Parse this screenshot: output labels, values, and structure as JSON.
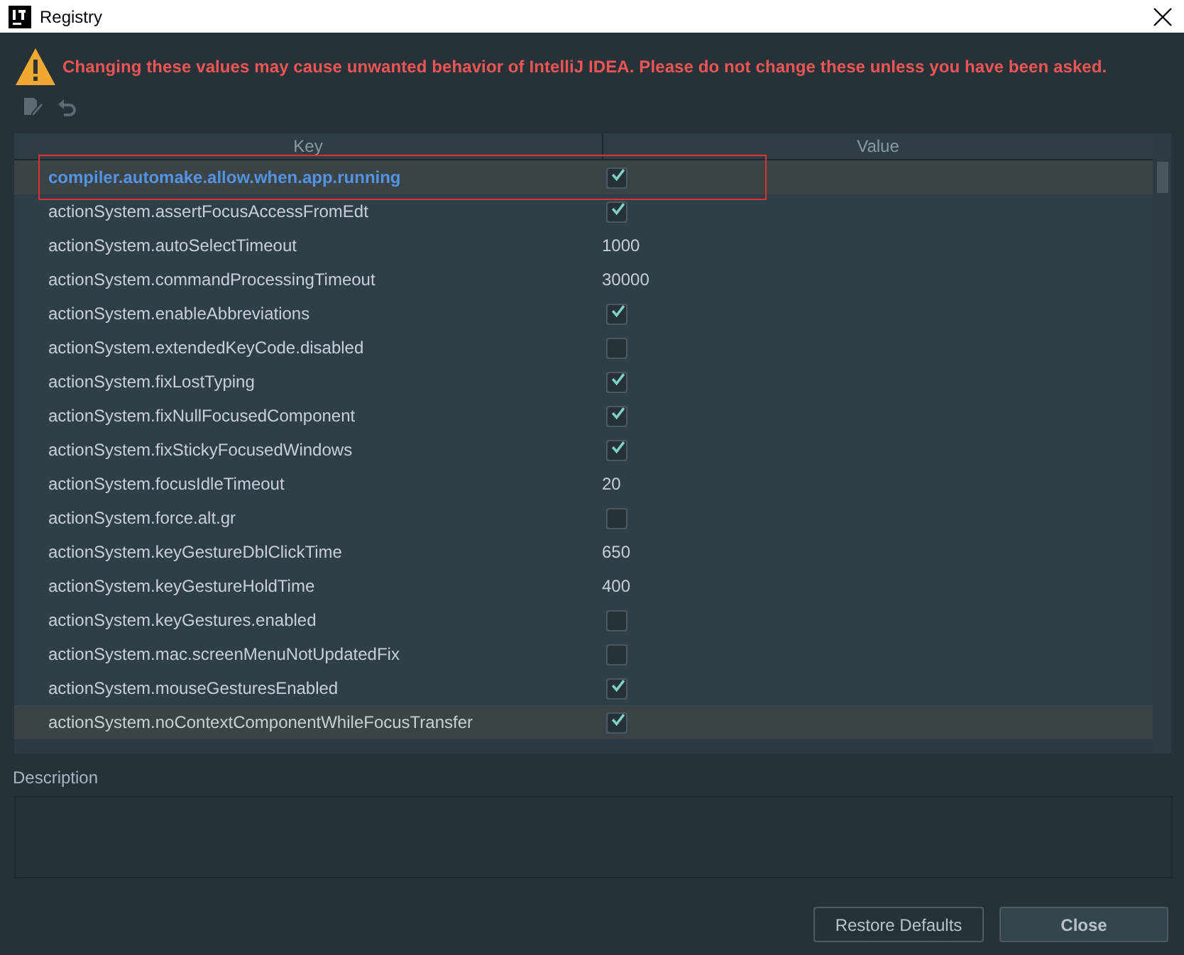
{
  "window": {
    "title": "Registry"
  },
  "warning": "Changing these values may cause unwanted behavior of IntelliJ IDEA. Please do not change these unless you have been asked.",
  "table": {
    "columns": [
      "Key",
      "Value"
    ],
    "annotation_box": true,
    "rows": [
      {
        "key": "compiler.automake.allow.when.app.running",
        "kind": "checkbox",
        "checked": true,
        "selected": true,
        "modified": true
      },
      {
        "key": "actionSystem.assertFocusAccessFromEdt",
        "kind": "checkbox",
        "checked": true,
        "selected": false,
        "modified": false
      },
      {
        "key": "actionSystem.autoSelectTimeout",
        "kind": "text",
        "value": "1000",
        "selected": false,
        "modified": false
      },
      {
        "key": "actionSystem.commandProcessingTimeout",
        "kind": "text",
        "value": "30000",
        "selected": false,
        "modified": false
      },
      {
        "key": "actionSystem.enableAbbreviations",
        "kind": "checkbox",
        "checked": true,
        "selected": false,
        "modified": false
      },
      {
        "key": "actionSystem.extendedKeyCode.disabled",
        "kind": "checkbox",
        "checked": false,
        "selected": false,
        "modified": false
      },
      {
        "key": "actionSystem.fixLostTyping",
        "kind": "checkbox",
        "checked": true,
        "selected": false,
        "modified": false
      },
      {
        "key": "actionSystem.fixNullFocusedComponent",
        "kind": "checkbox",
        "checked": true,
        "selected": false,
        "modified": false
      },
      {
        "key": "actionSystem.fixStickyFocusedWindows",
        "kind": "checkbox",
        "checked": true,
        "selected": false,
        "modified": false
      },
      {
        "key": "actionSystem.focusIdleTimeout",
        "kind": "text",
        "value": "20",
        "selected": false,
        "modified": false
      },
      {
        "key": "actionSystem.force.alt.gr",
        "kind": "checkbox",
        "checked": false,
        "selected": false,
        "modified": false
      },
      {
        "key": "actionSystem.keyGestureDblClickTime",
        "kind": "text",
        "value": "650",
        "selected": false,
        "modified": false
      },
      {
        "key": "actionSystem.keyGestureHoldTime",
        "kind": "text",
        "value": "400",
        "selected": false,
        "modified": false
      },
      {
        "key": "actionSystem.keyGestures.enabled",
        "kind": "checkbox",
        "checked": false,
        "selected": false,
        "modified": false
      },
      {
        "key": "actionSystem.mac.screenMenuNotUpdatedFix",
        "kind": "checkbox",
        "checked": false,
        "selected": false,
        "modified": false
      },
      {
        "key": "actionSystem.mouseGesturesEnabled",
        "kind": "checkbox",
        "checked": true,
        "selected": false,
        "modified": false
      },
      {
        "key": "actionSystem.noContextComponentWhileFocusTransfer",
        "kind": "checkbox",
        "checked": true,
        "selected": true,
        "modified": false
      }
    ]
  },
  "description": {
    "label": "Description"
  },
  "buttons": [
    {
      "label": "Restore Defaults",
      "kind": "normal"
    },
    {
      "label": "Close",
      "kind": "default"
    }
  ]
}
